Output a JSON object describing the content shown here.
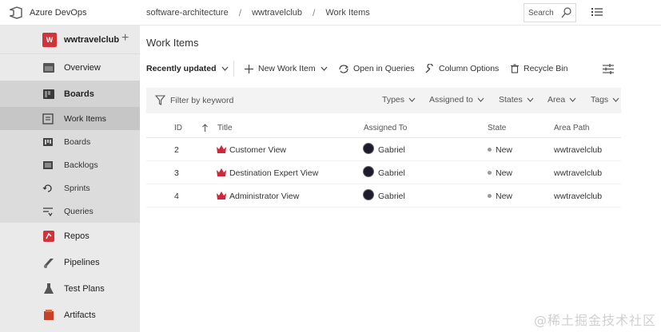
{
  "app": {
    "name": "Azure DevOps"
  },
  "breadcrumbs": [
    "software-architecture",
    "wwtravelclub",
    "Work Items"
  ],
  "search": {
    "placeholder": "Search"
  },
  "project": {
    "name": "wwtravelclub",
    "initial": "W"
  },
  "sidebar": {
    "items": [
      {
        "label": "Overview",
        "icon": "overview-icon"
      },
      {
        "label": "Boards",
        "icon": "boards-icon"
      },
      {
        "label": "Repos",
        "icon": "repos-icon"
      },
      {
        "label": "Pipelines",
        "icon": "pipelines-icon"
      },
      {
        "label": "Test Plans",
        "icon": "test-plans-icon"
      },
      {
        "label": "Artifacts",
        "icon": "artifacts-icon"
      }
    ],
    "boards_sub": [
      {
        "label": "Work Items",
        "icon": "work-items-icon"
      },
      {
        "label": "Boards",
        "icon": "boards-sub-icon"
      },
      {
        "label": "Backlogs",
        "icon": "backlogs-icon"
      },
      {
        "label": "Sprints",
        "icon": "sprints-icon"
      },
      {
        "label": "Queries",
        "icon": "queries-icon"
      }
    ]
  },
  "main": {
    "title": "Work Items",
    "toolbar": {
      "view": "Recently updated",
      "new_item": "New Work Item",
      "open_queries": "Open in Queries",
      "column_options": "Column Options",
      "recycle_bin": "Recycle Bin"
    },
    "filter": {
      "placeholder": "Filter by keyword",
      "dropdowns": [
        "Types",
        "Assigned to",
        "States",
        "Area",
        "Tags"
      ]
    },
    "table": {
      "columns": [
        "ID",
        "Title",
        "Assigned To",
        "State",
        "Area Path"
      ],
      "rows": [
        {
          "id": "2",
          "title": "Customer View",
          "assigned": "Gabriel",
          "state": "New",
          "area": "wwtravelclub"
        },
        {
          "id": "3",
          "title": "Destination Expert View",
          "assigned": "Gabriel",
          "state": "New",
          "area": "wwtravelclub"
        },
        {
          "id": "4",
          "title": "Administrator View",
          "assigned": "Gabriel",
          "state": "New",
          "area": "wwtravelclub"
        }
      ]
    }
  },
  "watermark": "@稀土掘金技术社区",
  "colors": {
    "accent": "#0078d4",
    "project": "#d13438",
    "work_item": "#cc293d"
  }
}
